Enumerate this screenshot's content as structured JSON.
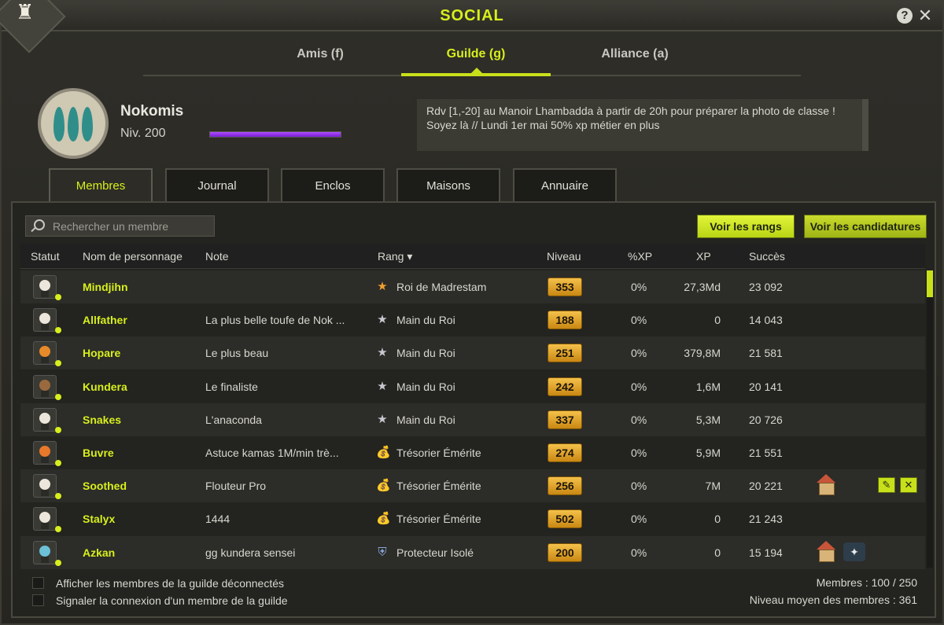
{
  "window": {
    "title": "SOCIAL",
    "help_label": "?",
    "close_label": "✕"
  },
  "top_tabs": [
    {
      "label": "Amis (f)",
      "active": false
    },
    {
      "label": "Guilde (g)",
      "active": true
    },
    {
      "label": "Alliance (a)",
      "active": false
    }
  ],
  "guild": {
    "name": "Nokomis",
    "level": "Niv. 200",
    "xp_progress": 1.0,
    "motd": "Rdv [1,-20] au Manoir Lhambadda à partir de 20h pour préparer la photo de classe ! Soyez là // Lundi 1er mai 50% xp métier en plus"
  },
  "sub_tabs": [
    {
      "label": "Membres",
      "active": true
    },
    {
      "label": "Journal",
      "active": false
    },
    {
      "label": "Enclos",
      "active": false
    },
    {
      "label": "Maisons",
      "active": false
    },
    {
      "label": "Annuaire",
      "active": false
    }
  ],
  "search": {
    "placeholder": "Rechercher un membre"
  },
  "buttons": {
    "ranks": "Voir les rangs",
    "applications": "Voir les candidatures"
  },
  "columns": {
    "status": "Statut",
    "name": "Nom de personnage",
    "note": "Note",
    "rank": "Rang ▾",
    "level": "Niveau",
    "xp_pct": "%XP",
    "xp": "XP",
    "success": "Succès"
  },
  "members": [
    {
      "name": "Mindjihn",
      "note": "",
      "rank": "Roi de Madrestam",
      "rank_icon": "gold-star-icon",
      "level": "353",
      "xp_pct": "0%",
      "xp": "27,3Md",
      "success": "23 092",
      "avatar_color": "#ece6dc",
      "extras": []
    },
    {
      "name": "Allfather",
      "note": "La plus belle toufe de Nok ...",
      "rank": "Main du Roi",
      "rank_icon": "silver-star-icon",
      "level": "188",
      "xp_pct": "0%",
      "xp": "0",
      "success": "14 043",
      "avatar_color": "#ece6dc",
      "extras": []
    },
    {
      "name": "Hopare",
      "note": "Le plus beau",
      "rank": "Main du Roi",
      "rank_icon": "silver-star-icon",
      "level": "251",
      "xp_pct": "0%",
      "xp": "379,8M",
      "success": "21 581",
      "avatar_color": "#e88a2a",
      "extras": []
    },
    {
      "name": "Kundera",
      "note": "Le finaliste",
      "rank": "Main du Roi",
      "rank_icon": "silver-star-icon",
      "level": "242",
      "xp_pct": "0%",
      "xp": "1,6M",
      "success": "20 141",
      "avatar_color": "#9a6a3e",
      "extras": []
    },
    {
      "name": "Snakes",
      "note": "L'anaconda",
      "rank": "Main du Roi",
      "rank_icon": "silver-star-icon",
      "level": "337",
      "xp_pct": "0%",
      "xp": "5,3M",
      "success": "20 726",
      "avatar_color": "#ece6dc",
      "extras": []
    },
    {
      "name": "Buvre",
      "note": "Astuce kamas 1M/min trè...",
      "rank": "Trésorier Émérite",
      "rank_icon": "money-bag-icon",
      "level": "274",
      "xp_pct": "0%",
      "xp": "5,9M",
      "success": "21 551",
      "avatar_color": "#e8782a",
      "extras": []
    },
    {
      "name": "Soothed",
      "note": "Flouteur Pro",
      "rank": "Trésorier Émérite",
      "rank_icon": "money-bag-icon",
      "level": "256",
      "xp_pct": "0%",
      "xp": "7M",
      "success": "20 221",
      "avatar_color": "#ece6dc",
      "extras": [
        "house",
        "edit",
        "kick"
      ]
    },
    {
      "name": "Stalyx",
      "note": "1444",
      "rank": "Trésorier Émérite",
      "rank_icon": "money-bag-icon",
      "level": "502",
      "xp_pct": "0%",
      "xp": "0",
      "success": "21 243",
      "avatar_color": "#ece6dc",
      "extras": []
    },
    {
      "name": "Azkan",
      "note": "gg kundera sensei",
      "rank": "Protecteur Isolé",
      "rank_icon": "shield-icon",
      "level": "200",
      "xp_pct": "0%",
      "xp": "0",
      "success": "15 194",
      "avatar_color": "#6cc0d8",
      "extras": [
        "house",
        "mount"
      ]
    }
  ],
  "footer": {
    "show_offline": "Afficher les membres de la guilde déconnectés",
    "notify_login": "Signaler la connexion d'un membre de la guilde",
    "members_count": "Membres : 100 / 250",
    "avg_level": "Niveau moyen des membres : 361"
  },
  "colors": {
    "accent": "#d7ef1c",
    "level_badge": "#e6a92a",
    "xp_bar": "#9b36f0"
  }
}
